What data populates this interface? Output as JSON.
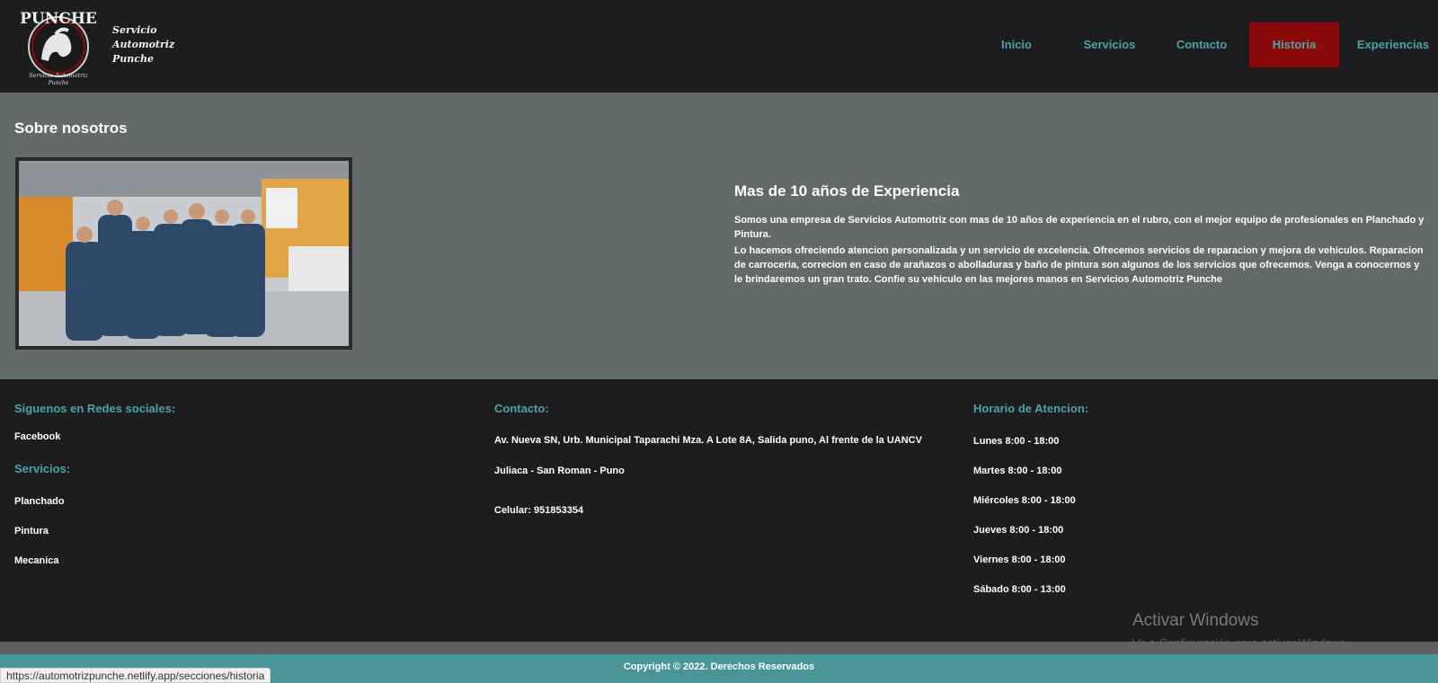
{
  "header": {
    "logo_text": "PUNCHE",
    "logo_subtitle": "Servicio Automotriz",
    "logo_subtitle2": "Punche",
    "brand_lines": [
      "Servicio",
      "Automotriz",
      "Punche"
    ],
    "nav": [
      {
        "label": "Inicio",
        "active": false
      },
      {
        "label": "Servicios",
        "active": false
      },
      {
        "label": "Contacto",
        "active": false
      },
      {
        "label": "Historia",
        "active": true
      },
      {
        "label": "Experiencias",
        "active": false
      }
    ]
  },
  "about": {
    "title": "Sobre nosotros",
    "exp_title": "Mas de 10 años de Experiencia",
    "p1": "Somos una empresa de Servicios Automotriz con mas de 10 años de experiencia en el rubro, con el mejor equipo de profesionales en Planchado y Pintura.",
    "p2": "Lo hacemos ofreciendo atencion personalizada y un servicio de excelencia. Ofrecemos servicios de reparacion y mejora de vehiculos. Reparacion de carroceria, correcion en caso de arañazos o abolladuras y baño de pintura son algunos de los servicios que ofrecemos. Venga a conocernos y le brindaremos un gran trato. Confie su vehiculo en las mejores manos en Servicios Automotriz Punche"
  },
  "footer": {
    "social_title": "Siguenos en Redes sociales:",
    "social_link": "Facebook",
    "services_title": "Servicios:",
    "services": [
      "Planchado",
      "Pintura",
      "Mecanica"
    ],
    "contact_title": "Contacto:",
    "address": "Av. Nueva SN, Urb. Municipal Taparachi Mza. A Lote 8A, Salida puno, Al frente de la UANCV",
    "city": "Juliaca - San Roman - Puno",
    "phone": "Celular: 951853354",
    "hours_title": "Horario de Atencion:",
    "hours": [
      "Lunes 8:00 - 18:00",
      "Martes 8:00 - 18:00",
      "Miércoles 8:00 - 18:00",
      "Jueves 8:00 - 18:00",
      "Viernes 8:00 - 18:00",
      "Sábado 8:00 - 13:00"
    ]
  },
  "copyright": "Copyright © 2022. Derechos Reservados",
  "windows": {
    "title": "Activar Windows",
    "subtitle": "Ve a Configuración para activar Windows."
  },
  "status_url": "https://automotrizpunche.netlify.app/secciones/historia",
  "colors": {
    "accent": "#4aa3a8",
    "active_nav": "#8b0a0a",
    "header_bg": "#1d1c1e",
    "section_bg": "#636a6a",
    "copyright_bg": "#4a9595"
  }
}
